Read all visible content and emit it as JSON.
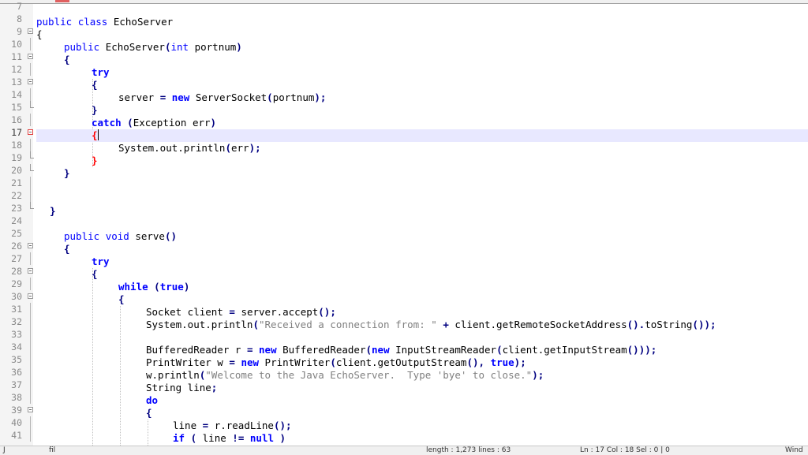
{
  "editor": {
    "current_line": "17",
    "lines": [
      {
        "n": "7",
        "fold": ""
      },
      {
        "n": "8",
        "fold": ""
      },
      {
        "n": "9",
        "fold": "open"
      },
      {
        "n": "10",
        "fold": "line"
      },
      {
        "n": "11",
        "fold": "open"
      },
      {
        "n": "12",
        "fold": "line"
      },
      {
        "n": "13",
        "fold": "open"
      },
      {
        "n": "14",
        "fold": "line"
      },
      {
        "n": "15",
        "fold": "end"
      },
      {
        "n": "16",
        "fold": "line"
      },
      {
        "n": "17",
        "fold": "open"
      },
      {
        "n": "18",
        "fold": "line"
      },
      {
        "n": "19",
        "fold": "end"
      },
      {
        "n": "20",
        "fold": "end"
      },
      {
        "n": "21",
        "fold": "line"
      },
      {
        "n": "22",
        "fold": "line"
      },
      {
        "n": "23",
        "fold": "end"
      },
      {
        "n": "24",
        "fold": ""
      },
      {
        "n": "25",
        "fold": ""
      },
      {
        "n": "26",
        "fold": "open"
      },
      {
        "n": "27",
        "fold": "line"
      },
      {
        "n": "28",
        "fold": "open"
      },
      {
        "n": "29",
        "fold": "line"
      },
      {
        "n": "30",
        "fold": "open"
      },
      {
        "n": "31",
        "fold": "line"
      },
      {
        "n": "32",
        "fold": "line"
      },
      {
        "n": "33",
        "fold": "line"
      },
      {
        "n": "34",
        "fold": "line"
      },
      {
        "n": "35",
        "fold": "line"
      },
      {
        "n": "36",
        "fold": "line"
      },
      {
        "n": "37",
        "fold": "line"
      },
      {
        "n": "38",
        "fold": "line"
      },
      {
        "n": "39",
        "fold": "open"
      },
      {
        "n": "40",
        "fold": "line"
      },
      {
        "n": "41",
        "fold": "line"
      }
    ],
    "code": {
      "l8_public": "public",
      "l8_class": "class",
      "l8_name": "EchoServer",
      "l9_brace": "{",
      "l10_public": "public",
      "l10_ctor": "EchoServer",
      "l10_int": "int",
      "l10_param": "portnum",
      "l11_brace": "{",
      "l12_try": "try",
      "l13_brace": "{",
      "l14_server": "server",
      "l14_eq": "=",
      "l14_new": "new",
      "l14_rest": "ServerSocket",
      "l14_arg": "portnum",
      "l15_brace": "}",
      "l16_catch": "catch",
      "l16_args": "Exception err",
      "l17_brace": "{",
      "l18_call": "System.out.println",
      "l18_arg": "err",
      "l19_brace": "}",
      "l20_brace": "}",
      "l23_brace": "}",
      "l25_public": "public",
      "l25_void": "void",
      "l25_name": "serve",
      "l26_brace": "{",
      "l27_try": "try",
      "l28_brace": "{",
      "l29_while": "while",
      "l29_true": "true",
      "l30_brace": "{",
      "l31_type": "Socket client",
      "l31_eq": "=",
      "l31_call": "server.accept",
      "l32_call": "System.out.println",
      "l32_str": "\"Received a connection from: \"",
      "l32_plus": "+",
      "l32_rest": "client.getRemoteSocketAddress",
      "l32_tostr": "toString",
      "l34_type": "BufferedReader r",
      "l34_eq": "=",
      "l34_new": "new",
      "l34_cls": "BufferedReader",
      "l34_new2": "new",
      "l34_cls2": "InputStreamReader",
      "l34_call": "client.getInputStream",
      "l35_type": "PrintWriter w",
      "l35_eq": "=",
      "l35_new": "new",
      "l35_cls": "PrintWriter",
      "l35_call": "client.getOutputStream",
      "l35_true": "true",
      "l36_call": "w.println",
      "l36_str": "\"Welcome to the Java EchoServer.  Type 'bye' to close.\"",
      "l37_text": "String line",
      "l38_do": "do",
      "l39_brace": "{",
      "l40_lhs": "line",
      "l40_eq": "=",
      "l40_call": "r.readLine",
      "l41_if": "if",
      "l41_line": "line",
      "l41_neq": "!=",
      "l41_null": "null"
    }
  },
  "statusbar": {
    "left": "J",
    "file": "fil",
    "length": "length : 1,273    lines : 63",
    "position": "Ln : 17    Col : 18    Sel : 0 | 0",
    "right": "Wind"
  }
}
